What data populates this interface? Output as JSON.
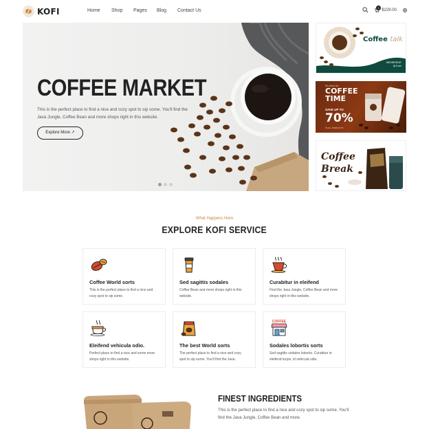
{
  "header": {
    "logo_text": "KOFI",
    "nav": [
      {
        "label": "Home"
      },
      {
        "label": "Shop"
      },
      {
        "label": "Pages"
      },
      {
        "label": "Blog"
      },
      {
        "label": "Contact Us"
      }
    ],
    "cart_count": "0",
    "cart_total": "$229.00",
    "icons": [
      "search-icon",
      "cart-icon",
      "settings-icon"
    ]
  },
  "hero": {
    "title": "COFFEE MARKET",
    "description": "This is the perfect place to find a nice and cozy spot to sip some. You'll find the Java Jungle, Coffee Bean and more shops right in this website.",
    "button_label": "Explore More",
    "slides": 3,
    "active_slide": 1
  },
  "banners": [
    {
      "title": "Coffee",
      "title_accent": "talk",
      "footer": "WEDNESDAY\n@ 8 am"
    },
    {
      "top_text": "It's time for",
      "title": "COFFEE\nTIME",
      "save": "SAVE UP TO",
      "percent": "70%",
      "footer": "IN ALL PRODUCTS"
    },
    {
      "title": "Coffee\nBreak"
    }
  ],
  "services": {
    "subheading": "What Happens Here",
    "heading": "EXPLORE KOFI SERVICE",
    "cards": [
      {
        "title": "Coffee World sorts",
        "text": "This is the perfect place to find a nice and cozy spot to sip some.",
        "icon": "coffee-beans-icon"
      },
      {
        "title": "Sed sagittis sodales",
        "text": "Coffee Bean and more shops right in this website.",
        "icon": "coffee-cup-icon"
      },
      {
        "title": "Curabitur in eleifend",
        "text": "Find the Java Jungle, Coffee Bean and more shops right in this website.",
        "icon": "hot-cup-icon"
      },
      {
        "title": "Eleifend vehicula odio.",
        "text": "Perfect place to find a nice and some more shops right in this website.",
        "icon": "steaming-cup-icon"
      },
      {
        "title": "The best World sorts",
        "text": "The perfect place to find a nice and cozy spot to sip some. You'll find the Java.",
        "icon": "coffee-bag-icon"
      },
      {
        "title": "Sodales lobortis sorts",
        "text": "Sed sagittis sodales lobortis. Curabitur in eleifend turpis, id vehicula odio.",
        "icon": "coffee-shop-icon",
        "icon_label": "COFFEE"
      }
    ]
  },
  "ingredients": {
    "title": "FINEST INGREDIENTS",
    "text": "This is the perfect place to find a nice and cozy spot to sip some. You'll find the Java Jungle, Coffee Bean and more."
  },
  "colors": {
    "accent": "#c9893f",
    "dark": "#222222",
    "banner_green": "#0f4a3e",
    "banner_brown": "#6b2a10"
  }
}
